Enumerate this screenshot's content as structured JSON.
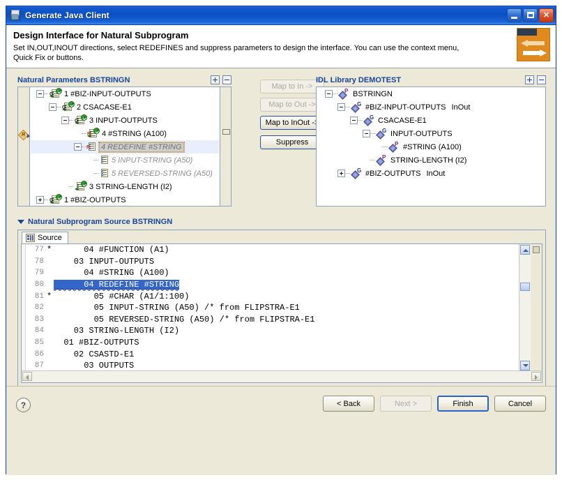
{
  "window": {
    "title": "Generate Java Client",
    "icon": "wizard-window-icon",
    "minimize_label": "_",
    "maximize_label": "□",
    "close_label": "✕"
  },
  "header": {
    "title": "Design Interface for Natural Subprogram",
    "description": "Set IN,OUT,INOUT directions, select REDEFINES and suppress parameters to design the interface. You can use the context menu, Quick Fix or buttons.",
    "banner_icon": "mapping-arrows-banner"
  },
  "left_panel": {
    "title": "Natural Parameters BSTRINGN",
    "expand_all_label": "+",
    "collapse_all_label": "−",
    "ruler_marker": "R",
    "nodes": [
      {
        "indent": 0,
        "toggle": "minus",
        "icon": "group-inout-icon",
        "badge": "G",
        "label": "1 #BIZ-INPUT-OUTPUTS",
        "style": "normal"
      },
      {
        "indent": 1,
        "toggle": "minus",
        "icon": "group-inout-icon",
        "badge": "G",
        "label": "2 CSACASE-E1",
        "style": "normal"
      },
      {
        "indent": 2,
        "toggle": "minus",
        "icon": "group-inout-icon",
        "badge": "G",
        "label": "3 INPUT-OUTPUTS",
        "style": "normal"
      },
      {
        "indent": 3,
        "toggle": "none",
        "icon": "group-inout-icon",
        "badge": "R",
        "label": "4 #STRING (A100)",
        "style": "normal"
      },
      {
        "indent": 3,
        "toggle": "minus",
        "icon": "redefine-doc-icon",
        "badge": "R",
        "label": "4 REDEFINE #STRING",
        "style": "selected"
      },
      {
        "indent": 4,
        "toggle": "none",
        "icon": "doc-icon",
        "badge": "",
        "label": "5 INPUT-STRING (A50)",
        "style": "suppressed"
      },
      {
        "indent": 4,
        "toggle": "none",
        "icon": "doc-icon",
        "badge": "",
        "label": "5 REVERSED-STRING (A50)",
        "style": "suppressed"
      },
      {
        "indent": 2,
        "toggle": "none",
        "icon": "group-inout-icon",
        "badge": "",
        "label": "3 STRING-LENGTH (I2)",
        "style": "normal"
      },
      {
        "indent": 0,
        "toggle": "plus",
        "icon": "group-inout-icon",
        "badge": "G",
        "label": "1 #BIZ-OUTPUTS",
        "style": "normal"
      }
    ]
  },
  "right_panel": {
    "title": "IDL Library DEMOTEST",
    "expand_all_label": "+",
    "collapse_all_label": "−",
    "nodes": [
      {
        "indent": 0,
        "toggle": "minus",
        "badge": "P",
        "label": "BSTRINGN",
        "direction": ""
      },
      {
        "indent": 1,
        "toggle": "minus",
        "badge": "G",
        "label": "#BIZ-INPUT-OUTPUTS",
        "direction": "InOut"
      },
      {
        "indent": 2,
        "toggle": "minus",
        "badge": "G",
        "label": "CSACASE-E1",
        "direction": ""
      },
      {
        "indent": 3,
        "toggle": "minus",
        "badge": "G",
        "label": "INPUT-OUTPUTS",
        "direction": ""
      },
      {
        "indent": 4,
        "toggle": "none",
        "badge": "P",
        "label": "#STRING  (A100)",
        "direction": ""
      },
      {
        "indent": 3,
        "toggle": "none",
        "badge": "P",
        "label": "STRING-LENGTH  (I2)",
        "direction": ""
      },
      {
        "indent": 1,
        "toggle": "plus",
        "badge": "G",
        "label": "#BIZ-OUTPUTS",
        "direction": "InOut"
      }
    ]
  },
  "map_buttons": [
    {
      "label": "Map to In ->",
      "state": "disabled"
    },
    {
      "label": "Map to Out ->",
      "state": "disabled"
    },
    {
      "label": "Map to InOut ->",
      "state": "enabled"
    },
    {
      "label": "Suppress",
      "state": "enabled"
    }
  ],
  "source_section": {
    "title": "Natural Subprogram Source BSTRINGN",
    "tab_label": "Source",
    "tab_icon": "source-tab-icon",
    "lines": [
      {
        "no": "77",
        "mark": "*",
        "text": "      04 #FUNCTION (A1)",
        "highlight": false
      },
      {
        "no": "78",
        "mark": "",
        "text": "    03 INPUT-OUTPUTS",
        "highlight": false
      },
      {
        "no": "79",
        "mark": "",
        "text": "      04 #STRING (A100)",
        "highlight": false
      },
      {
        "no": "80",
        "mark": "",
        "text": "      04 REDEFINE #STRING",
        "highlight": true
      },
      {
        "no": "81",
        "mark": "*",
        "text": "        05 #CHAR (A1/1:100)",
        "highlight": false
      },
      {
        "no": "82",
        "mark": "",
        "text": "        05 INPUT-STRING (A50) /* from FLIPSTRA-E1",
        "highlight": false
      },
      {
        "no": "83",
        "mark": "",
        "text": "        05 REVERSED-STRING (A50) /* from FLIPSTRA-E1",
        "highlight": false
      },
      {
        "no": "84",
        "mark": "",
        "text": "    03 STRING-LENGTH (I2)",
        "highlight": false
      },
      {
        "no": "85",
        "mark": "",
        "text": "  01 #BIZ-OUTPUTS",
        "highlight": false
      },
      {
        "no": "86",
        "mark": "",
        "text": "    02 CSASTD-E1",
        "highlight": false
      },
      {
        "no": "87",
        "mark": "",
        "text": "      03 OUTPUTS",
        "highlight": false
      }
    ]
  },
  "footer": {
    "help_label": "?",
    "buttons": [
      {
        "label": "< Back",
        "state": "enabled"
      },
      {
        "label": "Next >",
        "state": "disabled"
      },
      {
        "label": "Finish",
        "state": "default"
      },
      {
        "label": "Cancel",
        "state": "enabled"
      }
    ]
  },
  "colors": {
    "title_bar": "#0a4fc4",
    "panel_title": "#16449c",
    "selection_blue": "#3465c8",
    "banner_orange": "#e08a1e",
    "dialog_bg": "#ece9d8"
  }
}
